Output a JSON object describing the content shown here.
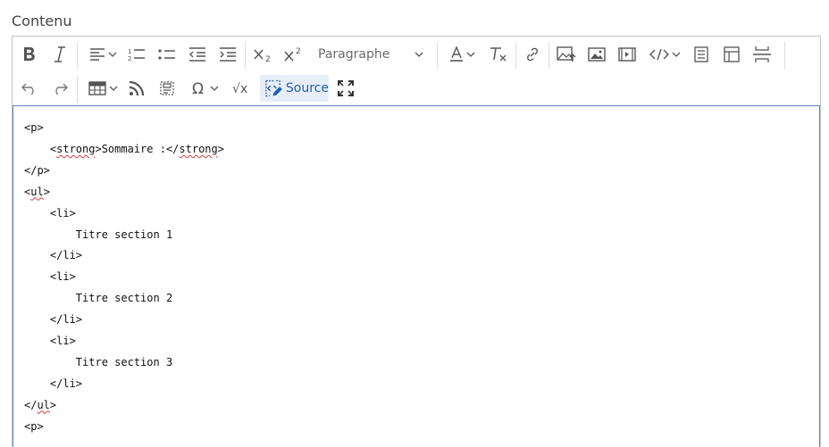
{
  "field": {
    "label": "Contenu"
  },
  "toolbar": {
    "heading_select": {
      "selected": "Paragraphe"
    },
    "source_label": "Source",
    "buttons": [
      "bold-icon",
      "italic-icon",
      "align-left-icon",
      "numbered-list-icon",
      "bulleted-list-icon",
      "outdent-icon",
      "indent-icon",
      "subscript-icon",
      "superscript-icon",
      "font-color-icon",
      "remove-format-icon",
      "link-icon",
      "image-upload-icon",
      "image-icon",
      "media-embed-icon",
      "code-block-icon",
      "page-break-icon",
      "template-icon",
      "horizontal-line-icon",
      "undo-icon",
      "redo-icon",
      "table-icon",
      "rss-icon",
      "html-embed-icon",
      "special-characters-icon",
      "math-icon",
      "source-icon",
      "fullscreen-icon"
    ]
  },
  "code": {
    "lines": [
      {
        "text": "<p>"
      },
      {
        "pre": "    <",
        "sq": "strong",
        "mid": ">Sommaire :</",
        "sq2": "strong",
        "post": ">"
      },
      {
        "text": "</p>"
      },
      {
        "pre": "<",
        "sq": "ul",
        "post": ">"
      },
      {
        "text": "    <li>"
      },
      {
        "text": "        Titre section 1"
      },
      {
        "text": "    </li>"
      },
      {
        "text": "    <li>"
      },
      {
        "text": "        Titre section 2"
      },
      {
        "text": "    </li>"
      },
      {
        "text": "    <li>"
      },
      {
        "text": "        Titre section 3"
      },
      {
        "text": "    </li>"
      },
      {
        "pre": "</",
        "sq": "ul",
        "post": ">"
      },
      {
        "text": "<p>"
      }
    ]
  },
  "colors": {
    "accent": "#1f5fb5",
    "focus_border": "#5a86c9",
    "toolbar_border": "#c4c4c4"
  }
}
